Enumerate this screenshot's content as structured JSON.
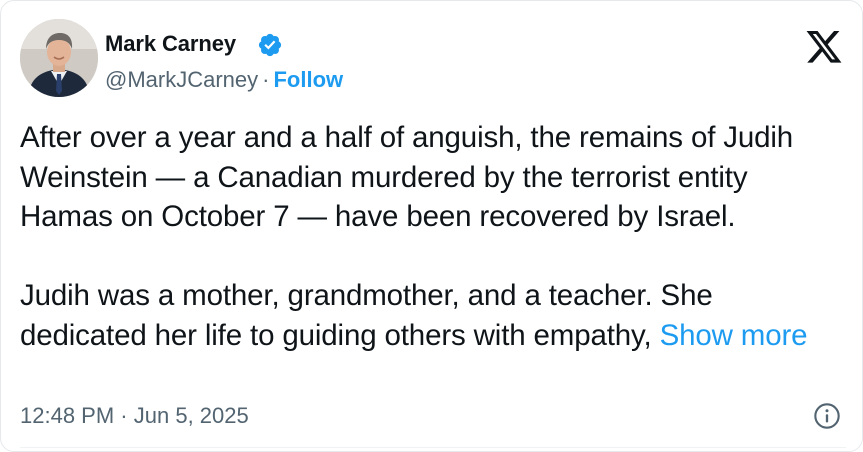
{
  "author": {
    "name": "Mark Carney",
    "handle": "@MarkJCarney",
    "separator": "·",
    "follow_label": "Follow",
    "verified": true,
    "avatar_icon": "profile-photo"
  },
  "tweet": {
    "paragraph_1": "After over a year and a half of anguish, the remains of Judih Weinstein — a Canadian murdered by the terrorist entity Hamas on October 7 — have been recovered by Israel.",
    "paragraph_2": "Judih was a mother, grandmother, and a teacher. She dedicated her life to guiding others with empathy,",
    "show_more_label": "Show more"
  },
  "footer": {
    "time": "12:48 PM",
    "separator": "·",
    "date": "Jun 5, 2025"
  },
  "icons": {
    "platform_logo": "x-logo-icon",
    "verified": "verified-badge-icon",
    "info": "info-icon"
  },
  "colors": {
    "accent": "#1d9bf0",
    "text_primary": "#0f1419",
    "text_secondary": "#536471"
  }
}
